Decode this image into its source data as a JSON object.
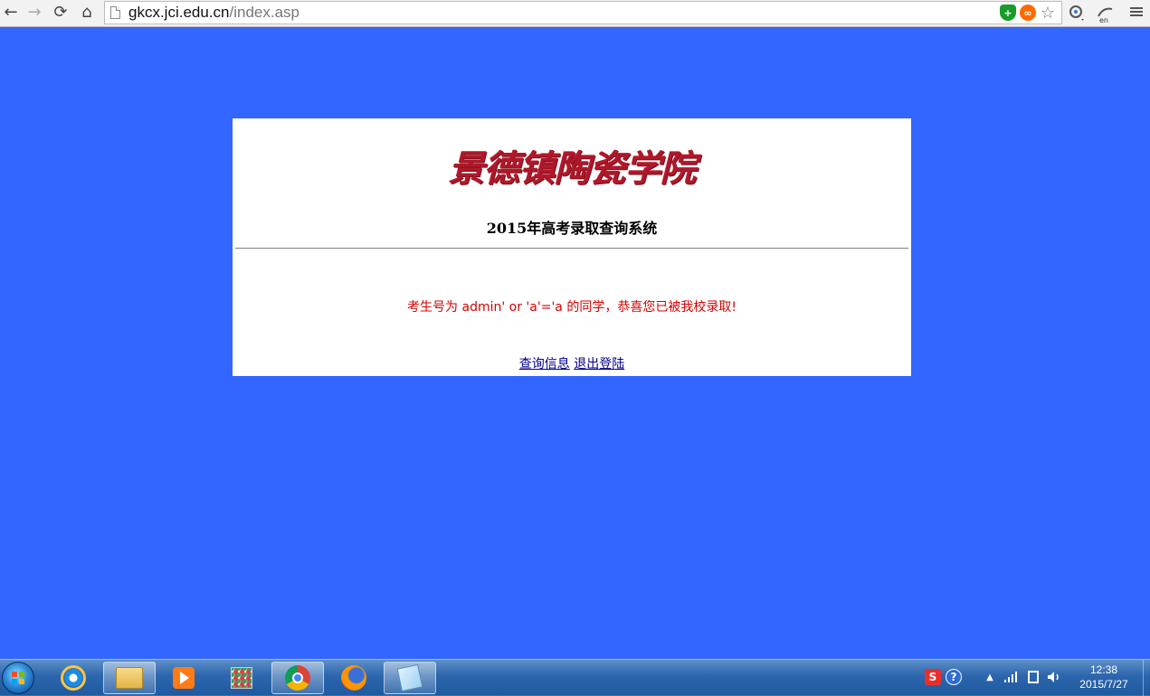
{
  "browser": {
    "back_label": "←",
    "forward_label": "→",
    "reload_label": "⟳",
    "home_label": "⌂",
    "url_host": "gkcx.jci.edu.cn",
    "url_path": "/index.asp",
    "extension_icons": [
      "shield-icon",
      "infinity-icon",
      "bookmark-star-icon",
      "translate-icon",
      "en-translate-icon",
      "menu-icon"
    ]
  },
  "page": {
    "logo_text": "景德镇陶瓷学院",
    "title": "2015年高考录取查询系统",
    "message": "考生号为 admin' or 'a'='a 的同学，恭喜您已被我校录取!",
    "links": {
      "query_info": "查询信息",
      "logout": "退出登陆"
    },
    "colors": {
      "background": "#3366ff",
      "panel": "#ffffff",
      "logo": "#b0182a",
      "message": "#d40000",
      "link": "#00008b"
    }
  },
  "taskbar": {
    "pinned": [
      "start-button",
      "internet-explorer-icon",
      "file-explorer-icon",
      "media-player-icon",
      "apps-icon",
      "chrome-icon",
      "firefox-icon",
      "notes-icon"
    ],
    "tray_sogou": "S",
    "tray_help": "?",
    "tray_arrow": "▲",
    "time": "12:38",
    "date": "2015/7/27"
  }
}
